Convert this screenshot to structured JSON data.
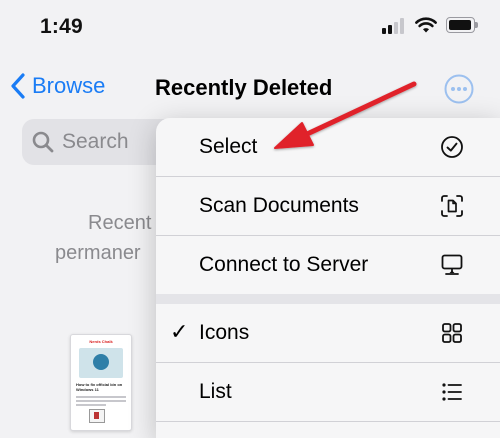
{
  "status_bar": {
    "time": "1:49",
    "signal_icon": "cellular-signal-icon",
    "wifi_icon": "wifi-icon",
    "battery_icon": "battery-icon"
  },
  "nav": {
    "back_label": "Browse",
    "title": "Recently Deleted",
    "more_icon": "ellipsis-circle-icon"
  },
  "search": {
    "placeholder": "Search"
  },
  "empty_state": {
    "line1": "Recent",
    "line2": "permaner"
  },
  "thumbnail": {
    "title": "Nerds Chalk",
    "heading": "How to fix official bin on Windows 11"
  },
  "menu": {
    "items": [
      {
        "label": "Select",
        "icon": "checkmark-circle-icon",
        "checked": false
      },
      {
        "label": "Scan Documents",
        "icon": "doc-viewfinder-icon",
        "checked": false
      },
      {
        "label": "Connect to Server",
        "icon": "display-server-icon",
        "checked": false
      },
      {
        "label": "Icons",
        "icon": "grid-icon",
        "checked": true,
        "check_glyph": "✓"
      },
      {
        "label": "List",
        "icon": "list-bullet-icon",
        "checked": false
      }
    ]
  },
  "colors": {
    "accent": "#1a7cf5",
    "annotation_arrow": "#e0202a",
    "background": "#f2f2f4"
  }
}
